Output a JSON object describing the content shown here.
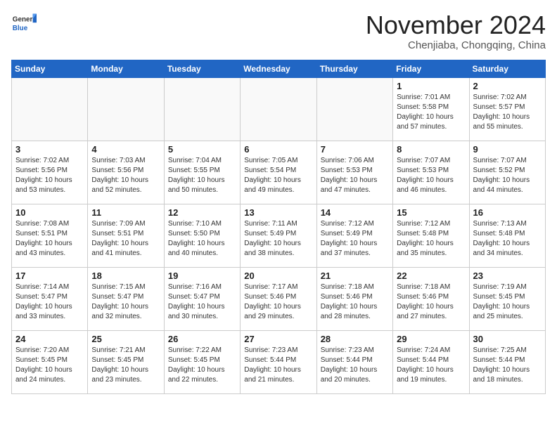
{
  "header": {
    "logo_general": "General",
    "logo_blue": "Blue",
    "month_title": "November 2024",
    "location": "Chenjiaba, Chongqing, China"
  },
  "days_of_week": [
    "Sunday",
    "Monday",
    "Tuesday",
    "Wednesday",
    "Thursday",
    "Friday",
    "Saturday"
  ],
  "weeks": [
    [
      {
        "day": "",
        "info": ""
      },
      {
        "day": "",
        "info": ""
      },
      {
        "day": "",
        "info": ""
      },
      {
        "day": "",
        "info": ""
      },
      {
        "day": "",
        "info": ""
      },
      {
        "day": "1",
        "info": "Sunrise: 7:01 AM\nSunset: 5:58 PM\nDaylight: 10 hours and 57 minutes."
      },
      {
        "day": "2",
        "info": "Sunrise: 7:02 AM\nSunset: 5:57 PM\nDaylight: 10 hours and 55 minutes."
      }
    ],
    [
      {
        "day": "3",
        "info": "Sunrise: 7:02 AM\nSunset: 5:56 PM\nDaylight: 10 hours and 53 minutes."
      },
      {
        "day": "4",
        "info": "Sunrise: 7:03 AM\nSunset: 5:56 PM\nDaylight: 10 hours and 52 minutes."
      },
      {
        "day": "5",
        "info": "Sunrise: 7:04 AM\nSunset: 5:55 PM\nDaylight: 10 hours and 50 minutes."
      },
      {
        "day": "6",
        "info": "Sunrise: 7:05 AM\nSunset: 5:54 PM\nDaylight: 10 hours and 49 minutes."
      },
      {
        "day": "7",
        "info": "Sunrise: 7:06 AM\nSunset: 5:53 PM\nDaylight: 10 hours and 47 minutes."
      },
      {
        "day": "8",
        "info": "Sunrise: 7:07 AM\nSunset: 5:53 PM\nDaylight: 10 hours and 46 minutes."
      },
      {
        "day": "9",
        "info": "Sunrise: 7:07 AM\nSunset: 5:52 PM\nDaylight: 10 hours and 44 minutes."
      }
    ],
    [
      {
        "day": "10",
        "info": "Sunrise: 7:08 AM\nSunset: 5:51 PM\nDaylight: 10 hours and 43 minutes."
      },
      {
        "day": "11",
        "info": "Sunrise: 7:09 AM\nSunset: 5:51 PM\nDaylight: 10 hours and 41 minutes."
      },
      {
        "day": "12",
        "info": "Sunrise: 7:10 AM\nSunset: 5:50 PM\nDaylight: 10 hours and 40 minutes."
      },
      {
        "day": "13",
        "info": "Sunrise: 7:11 AM\nSunset: 5:49 PM\nDaylight: 10 hours and 38 minutes."
      },
      {
        "day": "14",
        "info": "Sunrise: 7:12 AM\nSunset: 5:49 PM\nDaylight: 10 hours and 37 minutes."
      },
      {
        "day": "15",
        "info": "Sunrise: 7:12 AM\nSunset: 5:48 PM\nDaylight: 10 hours and 35 minutes."
      },
      {
        "day": "16",
        "info": "Sunrise: 7:13 AM\nSunset: 5:48 PM\nDaylight: 10 hours and 34 minutes."
      }
    ],
    [
      {
        "day": "17",
        "info": "Sunrise: 7:14 AM\nSunset: 5:47 PM\nDaylight: 10 hours and 33 minutes."
      },
      {
        "day": "18",
        "info": "Sunrise: 7:15 AM\nSunset: 5:47 PM\nDaylight: 10 hours and 32 minutes."
      },
      {
        "day": "19",
        "info": "Sunrise: 7:16 AM\nSunset: 5:47 PM\nDaylight: 10 hours and 30 minutes."
      },
      {
        "day": "20",
        "info": "Sunrise: 7:17 AM\nSunset: 5:46 PM\nDaylight: 10 hours and 29 minutes."
      },
      {
        "day": "21",
        "info": "Sunrise: 7:18 AM\nSunset: 5:46 PM\nDaylight: 10 hours and 28 minutes."
      },
      {
        "day": "22",
        "info": "Sunrise: 7:18 AM\nSunset: 5:46 PM\nDaylight: 10 hours and 27 minutes."
      },
      {
        "day": "23",
        "info": "Sunrise: 7:19 AM\nSunset: 5:45 PM\nDaylight: 10 hours and 25 minutes."
      }
    ],
    [
      {
        "day": "24",
        "info": "Sunrise: 7:20 AM\nSunset: 5:45 PM\nDaylight: 10 hours and 24 minutes."
      },
      {
        "day": "25",
        "info": "Sunrise: 7:21 AM\nSunset: 5:45 PM\nDaylight: 10 hours and 23 minutes."
      },
      {
        "day": "26",
        "info": "Sunrise: 7:22 AM\nSunset: 5:45 PM\nDaylight: 10 hours and 22 minutes."
      },
      {
        "day": "27",
        "info": "Sunrise: 7:23 AM\nSunset: 5:44 PM\nDaylight: 10 hours and 21 minutes."
      },
      {
        "day": "28",
        "info": "Sunrise: 7:23 AM\nSunset: 5:44 PM\nDaylight: 10 hours and 20 minutes."
      },
      {
        "day": "29",
        "info": "Sunrise: 7:24 AM\nSunset: 5:44 PM\nDaylight: 10 hours and 19 minutes."
      },
      {
        "day": "30",
        "info": "Sunrise: 7:25 AM\nSunset: 5:44 PM\nDaylight: 10 hours and 18 minutes."
      }
    ]
  ]
}
